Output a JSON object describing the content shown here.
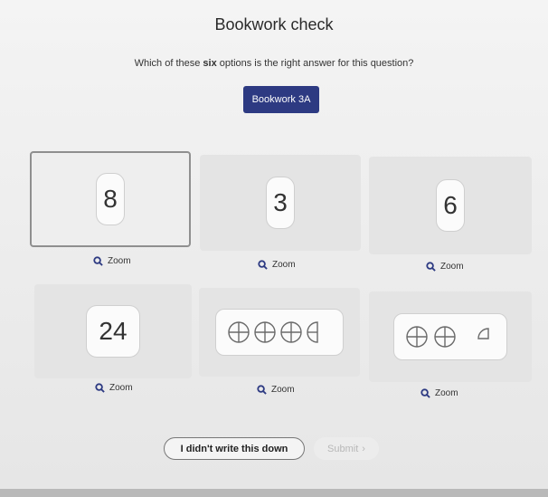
{
  "header": {
    "title": "Bookwork check",
    "question_prefix": "Which of these",
    "question_emphasis": "six",
    "question_suffix": "options is the right answer for this question?",
    "bookwork_code": "Bookwork 3A"
  },
  "options": [
    {
      "value": "8",
      "zoom_label": "Zoom",
      "selected": true
    },
    {
      "value": "3",
      "zoom_label": "Zoom",
      "selected": false
    },
    {
      "value": "6",
      "zoom_label": "Zoom",
      "selected": false
    },
    {
      "value": "24",
      "zoom_label": "Zoom",
      "selected": false
    },
    {
      "shape": "three-and-a-half circles (quartered)",
      "zoom_label": "Zoom",
      "selected": false
    },
    {
      "shape": "two circles and a quarter circle",
      "zoom_label": "Zoom",
      "selected": false
    }
  ],
  "footer": {
    "didnt_write_label": "I didn't write this down",
    "submit_label": "Submit",
    "submit_icon": "chevron-right-icon"
  },
  "colors": {
    "badge_background": "#2d3a82",
    "zoom_icon": "#2d3a82"
  }
}
